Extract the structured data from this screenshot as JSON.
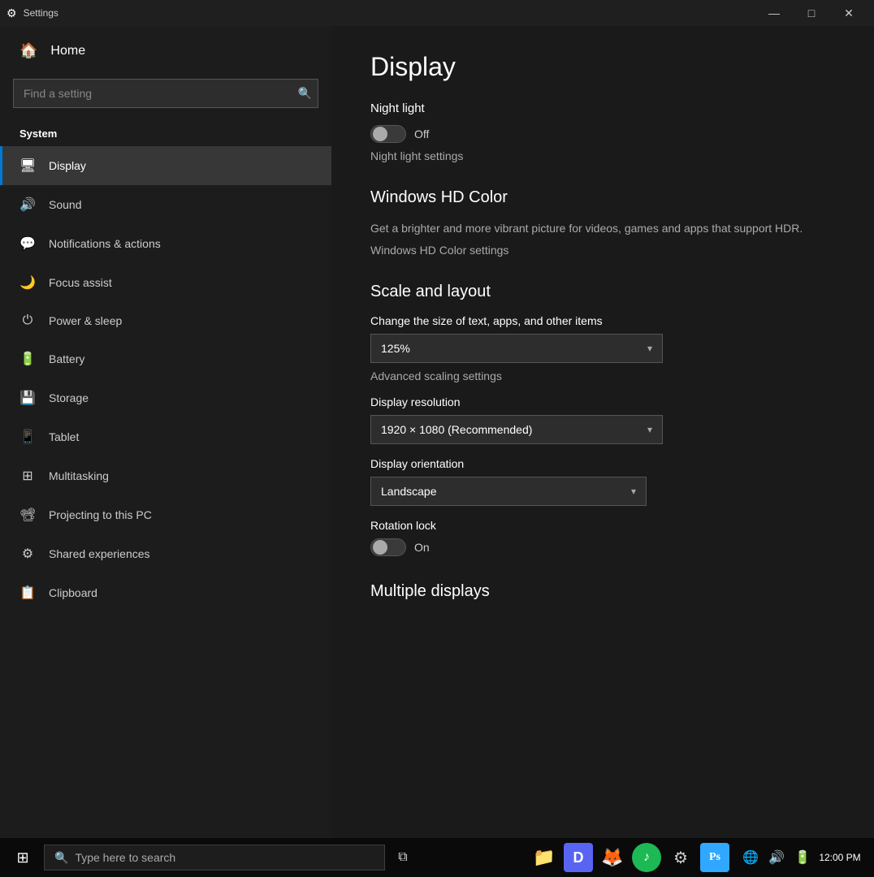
{
  "window": {
    "title": "Settings",
    "controls": {
      "minimize": "—",
      "maximize": "□",
      "close": "✕"
    }
  },
  "sidebar": {
    "home_label": "Home",
    "search_placeholder": "Find a setting",
    "system_label": "System",
    "nav_items": [
      {
        "id": "display",
        "label": "Display",
        "icon": "🖥",
        "active": true
      },
      {
        "id": "sound",
        "label": "Sound",
        "icon": "🔊",
        "active": false
      },
      {
        "id": "notifications",
        "label": "Notifications & actions",
        "icon": "💬",
        "active": false
      },
      {
        "id": "focus-assist",
        "label": "Focus assist",
        "icon": "🌙",
        "active": false
      },
      {
        "id": "power-sleep",
        "label": "Power & sleep",
        "icon": "⏻",
        "active": false
      },
      {
        "id": "battery",
        "label": "Battery",
        "icon": "🔋",
        "active": false
      },
      {
        "id": "storage",
        "label": "Storage",
        "icon": "💾",
        "active": false
      },
      {
        "id": "tablet",
        "label": "Tablet",
        "icon": "📱",
        "active": false
      },
      {
        "id": "multitasking",
        "label": "Multitasking",
        "icon": "⊞",
        "active": false
      },
      {
        "id": "projecting",
        "label": "Projecting to this PC",
        "icon": "📽",
        "active": false
      },
      {
        "id": "shared",
        "label": "Shared experiences",
        "icon": "⚙",
        "active": false
      },
      {
        "id": "clipboard",
        "label": "Clipboard",
        "icon": "📋",
        "active": false
      }
    ]
  },
  "main": {
    "page_title": "Display",
    "night_light": {
      "label": "Night light",
      "state": "Off",
      "toggle_on": false,
      "settings_link": "Night light settings"
    },
    "windows_hd_color": {
      "title": "Windows HD Color",
      "description": "Get a brighter and more vibrant picture for videos, games and apps that support HDR.",
      "settings_link": "Windows HD Color settings"
    },
    "scale_layout": {
      "title": "Scale and layout",
      "change_size_label": "Change the size of text, apps, and other items",
      "scale_value": "125%",
      "advanced_link": "Advanced scaling settings",
      "display_resolution_label": "Display resolution",
      "resolution_value": "1920 × 1080 (Recommended)",
      "display_orientation_label": "Display orientation",
      "orientation_value": "Landscape",
      "rotation_lock_label": "Rotation lock",
      "rotation_lock_state": "On",
      "rotation_lock_on": false
    },
    "multiple_displays": {
      "title": "Multiple displays"
    }
  },
  "taskbar": {
    "start_icon": "⊞",
    "search_placeholder": "Type here to search",
    "search_icon": "🔍",
    "apps": [
      {
        "id": "task-view",
        "icon": "⊟",
        "color": "#ffffff"
      },
      {
        "id": "file-explorer",
        "icon": "📁",
        "color": "#f0c040"
      },
      {
        "id": "discord",
        "icon": "Discord",
        "color": "#5865f2"
      },
      {
        "id": "firefox",
        "icon": "Firefox",
        "color": "#ff6611"
      },
      {
        "id": "spotify",
        "icon": "Spotify",
        "color": "#1db954"
      },
      {
        "id": "settings-app",
        "icon": "⚙",
        "color": "#cccccc"
      },
      {
        "id": "photoshop",
        "icon": "Ps",
        "color": "#31a8ff"
      }
    ]
  }
}
